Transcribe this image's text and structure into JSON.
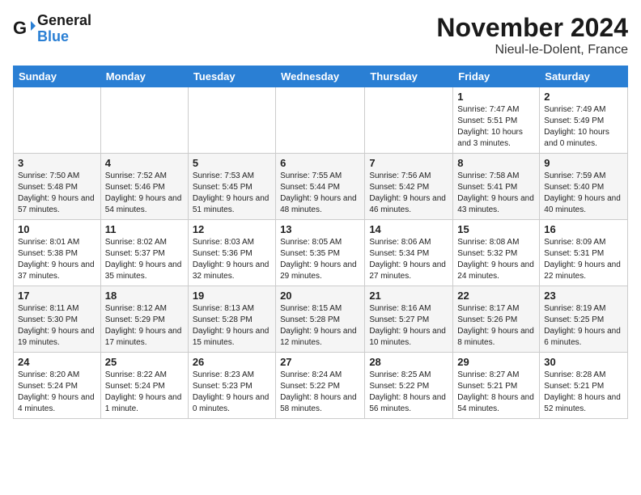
{
  "header": {
    "logo_line1": "General",
    "logo_line2": "Blue",
    "month_title": "November 2024",
    "location": "Nieul-le-Dolent, France"
  },
  "weekdays": [
    "Sunday",
    "Monday",
    "Tuesday",
    "Wednesday",
    "Thursday",
    "Friday",
    "Saturday"
  ],
  "weeks": [
    [
      {
        "day": "",
        "info": ""
      },
      {
        "day": "",
        "info": ""
      },
      {
        "day": "",
        "info": ""
      },
      {
        "day": "",
        "info": ""
      },
      {
        "day": "",
        "info": ""
      },
      {
        "day": "1",
        "info": "Sunrise: 7:47 AM\nSunset: 5:51 PM\nDaylight: 10 hours and 3 minutes."
      },
      {
        "day": "2",
        "info": "Sunrise: 7:49 AM\nSunset: 5:49 PM\nDaylight: 10 hours and 0 minutes."
      }
    ],
    [
      {
        "day": "3",
        "info": "Sunrise: 7:50 AM\nSunset: 5:48 PM\nDaylight: 9 hours and 57 minutes."
      },
      {
        "day": "4",
        "info": "Sunrise: 7:52 AM\nSunset: 5:46 PM\nDaylight: 9 hours and 54 minutes."
      },
      {
        "day": "5",
        "info": "Sunrise: 7:53 AM\nSunset: 5:45 PM\nDaylight: 9 hours and 51 minutes."
      },
      {
        "day": "6",
        "info": "Sunrise: 7:55 AM\nSunset: 5:44 PM\nDaylight: 9 hours and 48 minutes."
      },
      {
        "day": "7",
        "info": "Sunrise: 7:56 AM\nSunset: 5:42 PM\nDaylight: 9 hours and 46 minutes."
      },
      {
        "day": "8",
        "info": "Sunrise: 7:58 AM\nSunset: 5:41 PM\nDaylight: 9 hours and 43 minutes."
      },
      {
        "day": "9",
        "info": "Sunrise: 7:59 AM\nSunset: 5:40 PM\nDaylight: 9 hours and 40 minutes."
      }
    ],
    [
      {
        "day": "10",
        "info": "Sunrise: 8:01 AM\nSunset: 5:38 PM\nDaylight: 9 hours and 37 minutes."
      },
      {
        "day": "11",
        "info": "Sunrise: 8:02 AM\nSunset: 5:37 PM\nDaylight: 9 hours and 35 minutes."
      },
      {
        "day": "12",
        "info": "Sunrise: 8:03 AM\nSunset: 5:36 PM\nDaylight: 9 hours and 32 minutes."
      },
      {
        "day": "13",
        "info": "Sunrise: 8:05 AM\nSunset: 5:35 PM\nDaylight: 9 hours and 29 minutes."
      },
      {
        "day": "14",
        "info": "Sunrise: 8:06 AM\nSunset: 5:34 PM\nDaylight: 9 hours and 27 minutes."
      },
      {
        "day": "15",
        "info": "Sunrise: 8:08 AM\nSunset: 5:32 PM\nDaylight: 9 hours and 24 minutes."
      },
      {
        "day": "16",
        "info": "Sunrise: 8:09 AM\nSunset: 5:31 PM\nDaylight: 9 hours and 22 minutes."
      }
    ],
    [
      {
        "day": "17",
        "info": "Sunrise: 8:11 AM\nSunset: 5:30 PM\nDaylight: 9 hours and 19 minutes."
      },
      {
        "day": "18",
        "info": "Sunrise: 8:12 AM\nSunset: 5:29 PM\nDaylight: 9 hours and 17 minutes."
      },
      {
        "day": "19",
        "info": "Sunrise: 8:13 AM\nSunset: 5:28 PM\nDaylight: 9 hours and 15 minutes."
      },
      {
        "day": "20",
        "info": "Sunrise: 8:15 AM\nSunset: 5:28 PM\nDaylight: 9 hours and 12 minutes."
      },
      {
        "day": "21",
        "info": "Sunrise: 8:16 AM\nSunset: 5:27 PM\nDaylight: 9 hours and 10 minutes."
      },
      {
        "day": "22",
        "info": "Sunrise: 8:17 AM\nSunset: 5:26 PM\nDaylight: 9 hours and 8 minutes."
      },
      {
        "day": "23",
        "info": "Sunrise: 8:19 AM\nSunset: 5:25 PM\nDaylight: 9 hours and 6 minutes."
      }
    ],
    [
      {
        "day": "24",
        "info": "Sunrise: 8:20 AM\nSunset: 5:24 PM\nDaylight: 9 hours and 4 minutes."
      },
      {
        "day": "25",
        "info": "Sunrise: 8:22 AM\nSunset: 5:24 PM\nDaylight: 9 hours and 1 minute."
      },
      {
        "day": "26",
        "info": "Sunrise: 8:23 AM\nSunset: 5:23 PM\nDaylight: 9 hours and 0 minutes."
      },
      {
        "day": "27",
        "info": "Sunrise: 8:24 AM\nSunset: 5:22 PM\nDaylight: 8 hours and 58 minutes."
      },
      {
        "day": "28",
        "info": "Sunrise: 8:25 AM\nSunset: 5:22 PM\nDaylight: 8 hours and 56 minutes."
      },
      {
        "day": "29",
        "info": "Sunrise: 8:27 AM\nSunset: 5:21 PM\nDaylight: 8 hours and 54 minutes."
      },
      {
        "day": "30",
        "info": "Sunrise: 8:28 AM\nSunset: 5:21 PM\nDaylight: 8 hours and 52 minutes."
      }
    ]
  ]
}
